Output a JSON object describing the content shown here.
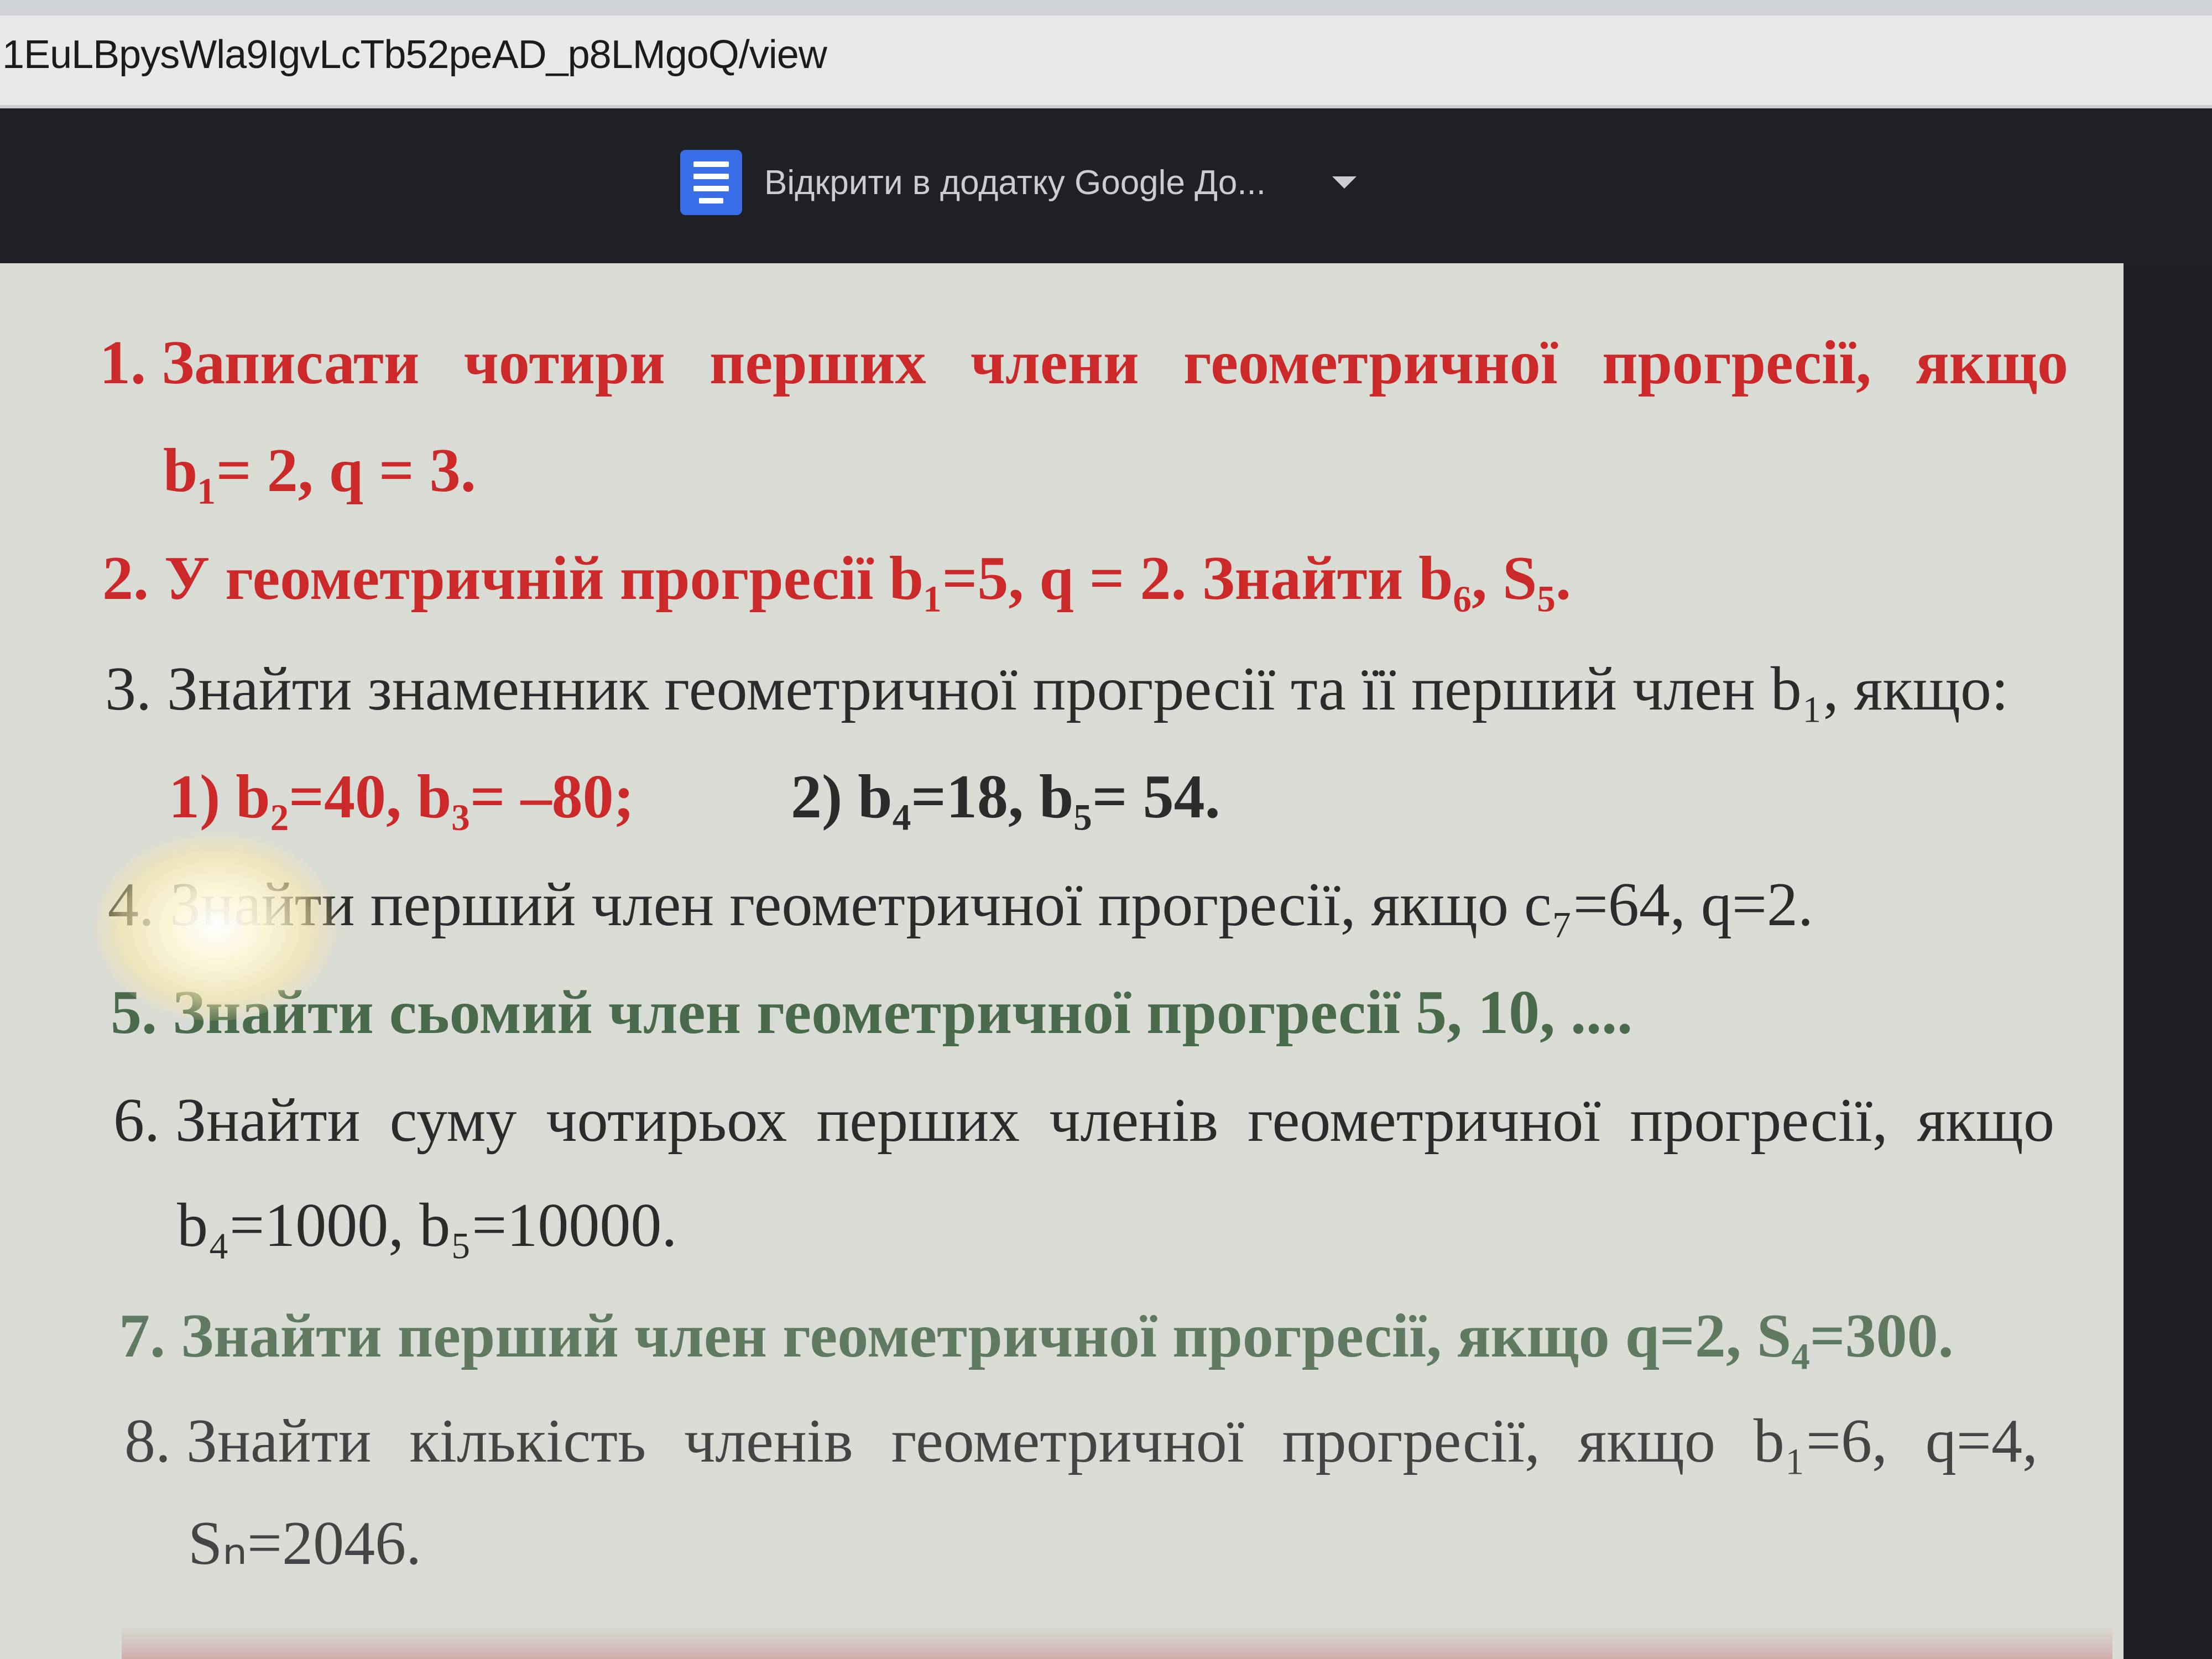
{
  "browser": {
    "url": "1EuLBpysWla9IgvLcTb52peAD_p8LMgoQ/view"
  },
  "viewer": {
    "open_in_app_label": "Відкрити в додатку Google До..."
  },
  "document": {
    "task1": {
      "line1_words": [
        "1. Записати",
        "чотири",
        "перших",
        "члени",
        "геометричної",
        "прогресії,",
        "якщо"
      ],
      "line2": "b₁= 2, q = 3."
    },
    "task2": "2. У геометричній прогресії b₁=5, q = 2. Знайти b₆, S₅.",
    "task3": {
      "line1": "3. Знайти знаменник геометричної прогресії та її перший член b₁, якщо:",
      "part1": "1) b₂=40,  b₃= –80;",
      "part2": "2) b₄=18, b₅= 54."
    },
    "task4": "4. Знайти перший член геометричної прогресії, якщо c₇=64,  q=2.",
    "task5": "5. Знайти сьомий член геометричної прогресії   5, 10, ....",
    "task6": {
      "line1_words": [
        "6. Знайти",
        "суму",
        "чотирьох",
        "перших",
        "членів",
        "геометричної",
        "прогресії,",
        "якщо"
      ],
      "line2": "b₄=1000, b₅=10000."
    },
    "task7": "7. Знайти перший член геометричної прогресії, якщо q=2, S₄=300.",
    "task8": {
      "line1_words": [
        "8. Знайти",
        "кількість",
        "членів",
        "геометричної",
        "прогресії,",
        "якщо",
        "b₁=6,",
        "q=4,"
      ],
      "line2": "Sₙ=2046."
    }
  }
}
